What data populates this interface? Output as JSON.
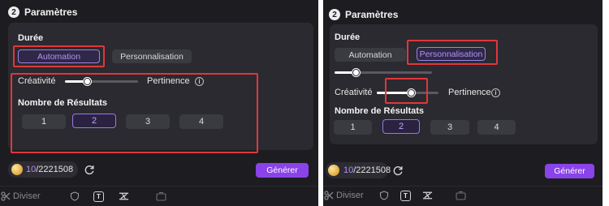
{
  "section": {
    "step": "2",
    "title": "Paramètres"
  },
  "duree_label": "Durée",
  "tabs": [
    {
      "label": "Automation"
    },
    {
      "label": "Personnalisation"
    }
  ],
  "creativite_label": "Créativité",
  "pertinence_label": "Pertinence",
  "info_glyph": "i",
  "results_label": "Nombre de Résultats",
  "result_options": [
    "1",
    "2",
    "3",
    "4"
  ],
  "selected_result": "2",
  "credits": {
    "used": "10",
    "total": "/2221508"
  },
  "generate_label": "Générer",
  "toolbar": {
    "diviser_label": "Diviser"
  },
  "left_view": {
    "selected_tab": "Automation",
    "creativity_level": 0.33
  },
  "right_view": {
    "selected_tab": "Personnalisation",
    "creativity_level": 0.55
  },
  "colors": {
    "accent": "#8a43e8",
    "selected_text": "#b393f4",
    "highlight": "#e0373b",
    "background": "#1d1d21",
    "card": "#2a2a30"
  },
  "icons": [
    "step-number-icon",
    "info-icon",
    "coin-icon",
    "refresh-icon",
    "split-icon",
    "shield-icon",
    "text-icon",
    "magic-wand-icon",
    "image-icon"
  ]
}
